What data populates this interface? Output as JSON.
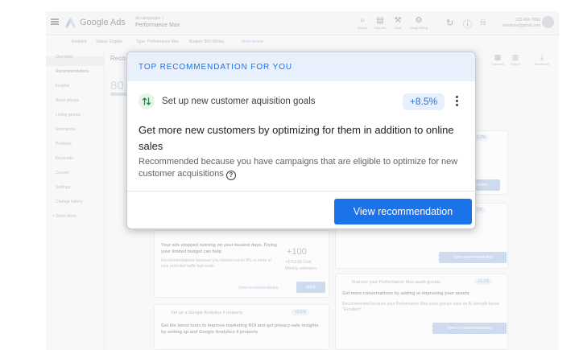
{
  "app": {
    "brand": "Google Ads",
    "breadcrumb": "All campaigns  >",
    "campaign": "Performance Max",
    "toolbar": [
      "Search",
      "Reports",
      "Tools",
      "Refresh",
      "Help",
      "Notifications"
    ],
    "toolbar_labels": {
      "search": "Search",
      "reports": "Reports",
      "tools": "Tools",
      "setup": "Setup Billing"
    },
    "account_line1": "123-456-7890",
    "account_line2": "emailme@gmail.com"
  },
  "status": {
    "enabled": "Enabled",
    "status": "Status: Eligible",
    "type": "Type: Performance Max",
    "budget": "Budget: $60.00/day",
    "more": "More details"
  },
  "sidebar": {
    "items": [
      "Overview",
      "Recommendations",
      "Insights",
      "Asset groups",
      "Listing groups",
      "Extensions",
      "Products",
      "Keywords",
      "Ccount",
      "Settings",
      "Change history"
    ],
    "show_more": "Show More"
  },
  "main": {
    "title": "Reco",
    "score": "80",
    "right_tools": [
      "Columns",
      "Report",
      "Download"
    ]
  },
  "bg_cards": {
    "budget": {
      "title": "Your ads stopped running on your busiest days. Fixing your limited budget can help",
      "text": "Recommendations because you missed out on 8% or more of your potential traffic last week",
      "uplift": "+100",
      "value": "+$753.65 Cost",
      "sub": "Weekly estimates",
      "link": "View recommendation",
      "apply": "Apply"
    },
    "ga4": {
      "title": "Set up a Google Analytics 4 property",
      "uplift": "+0.6%",
      "text": "Get the latest tools to improve marketing ROI and get privacy-safe insights by setting up and Google Analytics 4 property"
    },
    "assets": {
      "title": "Improve your Performance Max asset groups",
      "uplift": "+1.1%",
      "headline": "Get more conversations by adding or improving your assets",
      "text": "Recommended because your Performance Max asset groups have an AI strength below \"Excellent\"",
      "button": "View 5 recommendations"
    },
    "right_top_button": "View recommendation",
    "right_mid_button": "View recommendation"
  },
  "modal": {
    "header": "TOP RECOMMENDATION FOR YOU",
    "rec_title": "Set up new customer aquisition goals",
    "uplift": "+8.5%",
    "headline": "Get more new customers by optimizing for them in addition to online sales",
    "reason": "Recommended because you have campaigns that are eligible to optimize for new customer acquisitions",
    "cta": "View recommendation"
  },
  "colors": {
    "accent": "#1a73e8",
    "header_bg": "#e8f0fe",
    "icon_green": "#1e8e3e"
  }
}
